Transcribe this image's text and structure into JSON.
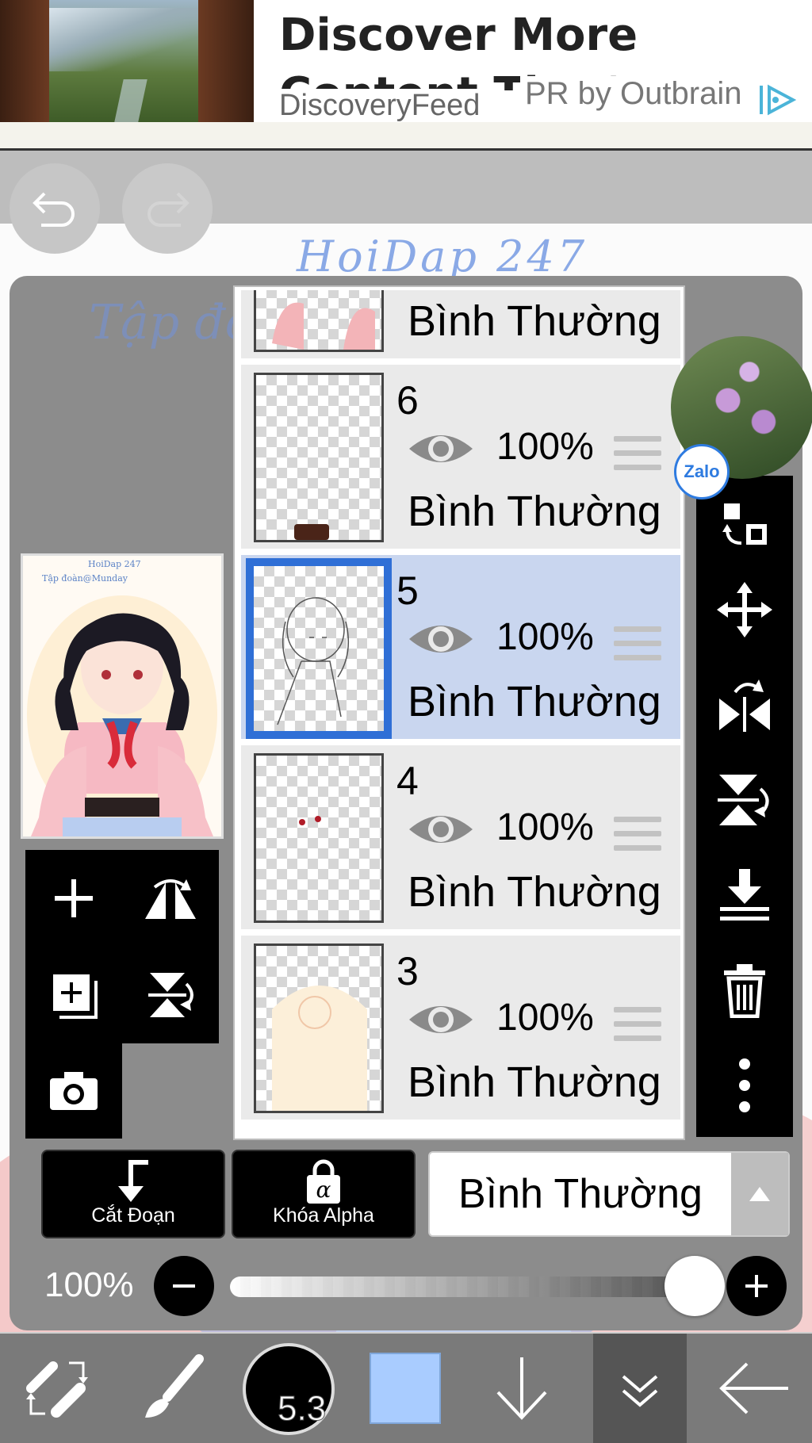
{
  "ad": {
    "title": "Discover More Content That's Right",
    "source": "DiscoveryFeed",
    "sponsor": "PR by Outbrain"
  },
  "canvas": {
    "watermark_top": "HoiDap 247",
    "watermark_left": "Tập đoà"
  },
  "layers": [
    {
      "number": "",
      "opacity": "",
      "blend": "Bình Thường",
      "selected": false
    },
    {
      "number": "6",
      "opacity": "100%",
      "blend": "Bình Thường",
      "selected": false
    },
    {
      "number": "5",
      "opacity": "100%",
      "blend": "Bình Thường",
      "selected": true
    },
    {
      "number": "4",
      "opacity": "100%",
      "blend": "Bình Thường",
      "selected": false
    },
    {
      "number": "3",
      "opacity": "100%",
      "blend": "Bình Thường",
      "selected": false
    }
  ],
  "zalo": {
    "label": "Zalo"
  },
  "controls": {
    "clip_label": "Cắt Đoạn",
    "alpha_label": "Khóa Alpha",
    "blend_mode": "Bình Thường",
    "opacity_label": "100%",
    "opacity_value": 0.96
  },
  "toolbar": {
    "brush_size": "5.3",
    "color": "#a9ccff"
  },
  "icons": [
    "undo-icon",
    "redo-icon",
    "add-layer-icon",
    "flip-horizontal-icon",
    "duplicate-layer-icon",
    "flip-vertical-icon",
    "camera-icon",
    "transform-icon",
    "move-icon",
    "flip-h-icon",
    "flip-v-icon",
    "merge-down-icon",
    "trash-icon",
    "more-icon",
    "tool-switch-icon",
    "brush-icon",
    "arrow-down-icon",
    "layers-collapse-icon",
    "back-arrow-icon"
  ]
}
